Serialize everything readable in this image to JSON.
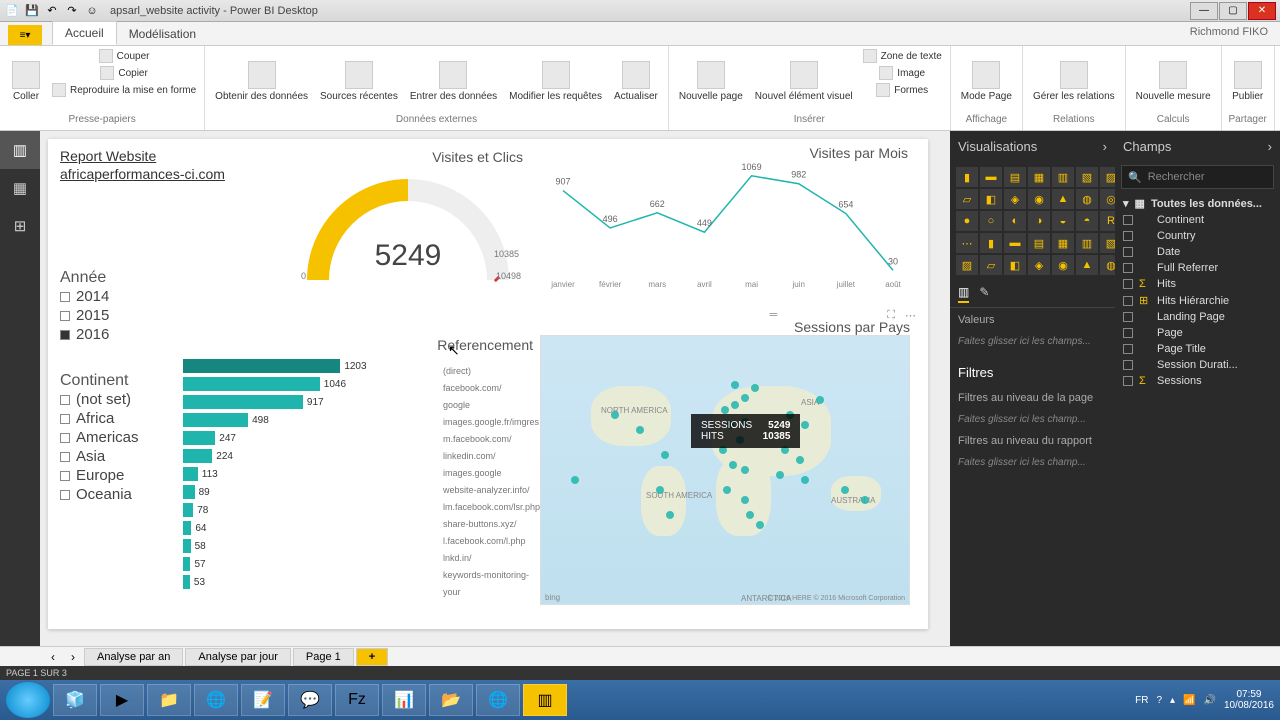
{
  "window": {
    "title": "apsarl_website activity - Power BI Desktop",
    "user": "Richmond FIKO"
  },
  "ribbon": {
    "tabs": [
      "Accueil",
      "Modélisation"
    ],
    "groups": {
      "clipboard": {
        "label": "Presse-papiers",
        "paste": "Coller",
        "cut": "Couper",
        "copy": "Copier",
        "format": "Reproduire la mise en forme"
      },
      "external": {
        "label": "Données externes",
        "getdata": "Obtenir des\ndonnées",
        "recent": "Sources\nrécentes",
        "enter": "Entrer des\ndonnées",
        "edit": "Modifier les\nrequêtes",
        "refresh": "Actualiser"
      },
      "insert": {
        "label": "Insérer",
        "newpage": "Nouvelle\npage",
        "newvisual": "Nouvel\nélément visuel",
        "textbox": "Zone de texte",
        "image": "Image",
        "shapes": "Formes"
      },
      "view": {
        "label": "Affichage",
        "pagemode": "Mode\nPage"
      },
      "relations": {
        "label": "Relations",
        "manage": "Gérer les\nrelations"
      },
      "calc": {
        "label": "Calculs",
        "measure": "Nouvelle\nmesure"
      },
      "share": {
        "label": "Partager",
        "publish": "Publier"
      }
    }
  },
  "panes": {
    "viz": {
      "title": "Visualisations",
      "values": "Valeurs",
      "drop1": "Faites glisser ici les champs...",
      "filters": "Filtres",
      "pagefilter": "Filtres au niveau de la page",
      "drop2": "Faites glisser ici les champ...",
      "reportfilter": "Filtres au niveau du rapport",
      "drop3": "Faites glisser ici les champ..."
    },
    "fields": {
      "title": "Champs",
      "searchPlaceholder": "Rechercher",
      "table": "Toutes les données...",
      "list": [
        "Continent",
        "Country",
        "Date",
        "Full Referrer",
        "Hits",
        "Hits Hiérarchie",
        "Landing Page",
        "Page",
        "Page Title",
        "Session Durati...",
        "Sessions"
      ]
    }
  },
  "report": {
    "title": "Report Website",
    "subtitle": "africaperformances-ci.com",
    "gauge": {
      "title": "Visites et Clics",
      "value": "5249",
      "min": "0",
      "mark": "10385",
      "max": "10498"
    },
    "line": {
      "title": "Visites par Mois"
    },
    "bar": {
      "title": "Referencement"
    },
    "map": {
      "title": "Sessions par Pays",
      "tooltip": {
        "sessions_lbl": "SESSIONS",
        "sessions_val": "5249",
        "hits_lbl": "HITS",
        "hits_val": "10385"
      },
      "attr": "© 2016 HERE © 2016 Microsoft Corporation",
      "bing": "bing",
      "labels": {
        "na": "NORTH AMERICA",
        "sa": "SOUTH AMERICA",
        "asia": "ASIA",
        "aus": "AUSTRALIA",
        "ant": "ANTARCTICA"
      }
    },
    "year": {
      "title": "Année",
      "items": [
        "2014",
        "2015",
        "2016"
      ],
      "selected": "2016"
    },
    "continent": {
      "title": "Continent",
      "items": [
        "(not set)",
        "Africa",
        "Americas",
        "Asia",
        "Europe",
        "Oceania"
      ]
    }
  },
  "chart_data": {
    "line": {
      "type": "line",
      "title": "Visites par Mois",
      "categories": [
        "janvier",
        "février",
        "mars",
        "avril",
        "mai",
        "juin",
        "juillet",
        "août"
      ],
      "values": [
        907,
        496,
        662,
        449,
        1069,
        982,
        654,
        30
      ],
      "ylim": [
        0,
        1100
      ]
    },
    "bar": {
      "type": "bar",
      "title": "Referencement",
      "orientation": "horizontal",
      "categories": [
        "(direct)",
        "facebook.com/",
        "google",
        "images.google.fr/imgres",
        "m.facebook.com/",
        "linkedin.com/",
        "images.google",
        "website-analyzer.info/",
        "lm.facebook.com/lsr.php",
        "share-buttons.xyz/",
        "l.facebook.com/l.php",
        "lnkd.in/",
        "keywords-monitoring-your"
      ],
      "values": [
        1203,
        1046,
        917,
        498,
        247,
        224,
        113,
        89,
        78,
        64,
        58,
        57,
        53
      ],
      "xlim": [
        0,
        1300
      ]
    },
    "gauge": {
      "type": "gauge",
      "value": 5249,
      "min": 0,
      "max": 10498,
      "target": 10385
    },
    "map_tooltip": {
      "sessions": 5249,
      "hits": 10385
    }
  },
  "pagetabs": {
    "tabs": [
      "Analyse par an",
      "Analyse par jour",
      "Page 1"
    ],
    "add": "+"
  },
  "statusbar": {
    "text": "PAGE 1 SUR 3"
  },
  "taskbar": {
    "lang": "FR",
    "time": "07:59",
    "date": "10/08/2016"
  }
}
